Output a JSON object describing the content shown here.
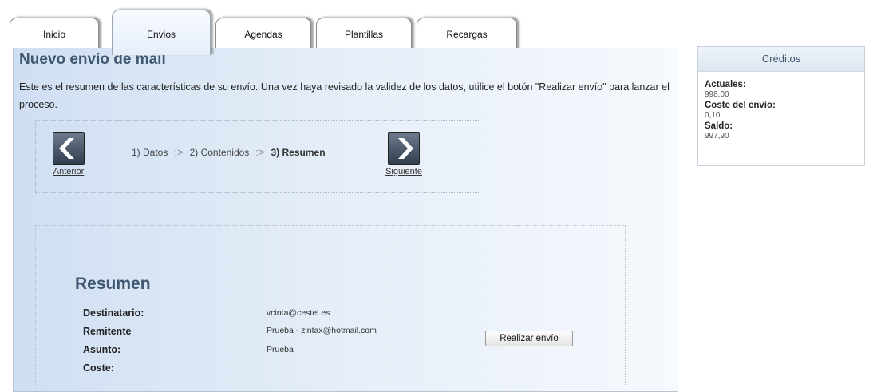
{
  "tabs": [
    {
      "label": "Inicio"
    },
    {
      "label": "Envios"
    },
    {
      "label": "Agendas"
    },
    {
      "label": "Plantillas"
    },
    {
      "label": "Recargas"
    }
  ],
  "page": {
    "title": "Nuevo envío de mail",
    "intro": "Este es el resumen de las características de su envío. Una vez haya revisado la validez de los datos, utilice el botón \"Realizar envío\" para lanzar el proceso."
  },
  "wizard": {
    "prev_label": "Anterior",
    "next_label": "Siguiente",
    "steps": [
      "1) Datos",
      "2) Contenidos",
      "3) Resumen"
    ],
    "separator": ":>"
  },
  "summary": {
    "title": "Resumen",
    "rows": [
      {
        "label": "Destinatario:",
        "value": "vcinta@cestel.es"
      },
      {
        "label": "Remitente",
        "value": "Prueba - zintax@hotmail.com"
      },
      {
        "label": "Asunto:",
        "value": "Prueba"
      },
      {
        "label": "Coste:",
        "value": ""
      }
    ],
    "send_label": "Realizar envío"
  },
  "credits": {
    "title": "Créditos",
    "items": [
      {
        "label": "Actuales:",
        "value": "998,00"
      },
      {
        "label": "Coste del envío:",
        "value": "0,10"
      },
      {
        "label": "Saldo:",
        "value": "997,90"
      }
    ]
  }
}
